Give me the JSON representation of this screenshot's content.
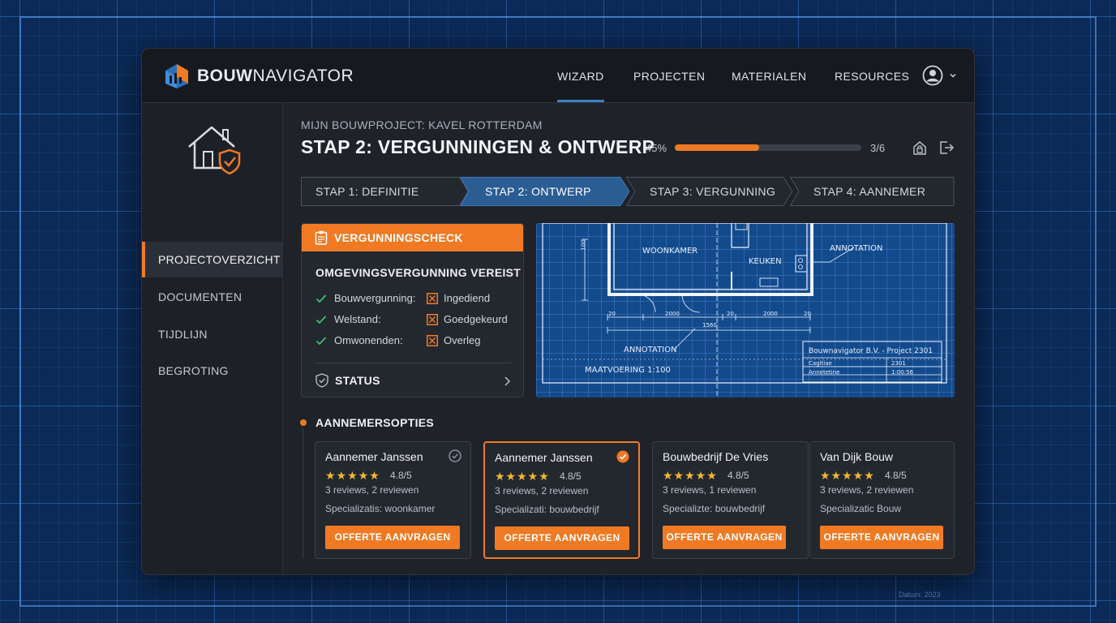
{
  "app": {
    "brand_bold": "BOUW",
    "brand_light": "NAVIGATOR"
  },
  "nav": {
    "items": [
      {
        "label": "WIZARD",
        "active": true
      },
      {
        "label": "PROJECTEN",
        "active": false
      },
      {
        "label": "MATERIALEN",
        "active": false
      },
      {
        "label": "RESOURCES",
        "active": false
      }
    ]
  },
  "sidebar": {
    "items": [
      {
        "label": "PROJECTOVERZICHT",
        "active": true
      },
      {
        "label": "DOCUMENTEN",
        "active": false
      },
      {
        "label": "TIJDLIJN",
        "active": false
      },
      {
        "label": "BEGROTING",
        "active": false
      }
    ]
  },
  "main": {
    "breadcrumb": "MIJN BOUWPROJECT: KAVEL ROTTERDAM",
    "title": "STAP 2: VERGUNNINGEN & ONTWERP",
    "progress_label": "45%",
    "progress_value": 0.45,
    "step_count": "3/6",
    "steps": [
      {
        "label": "STAP 1: DEFINITIE",
        "active": false
      },
      {
        "label": "STAP 2: ONTWERP",
        "active": true
      },
      {
        "label": "STAP 3: VERGUNNING",
        "active": false
      },
      {
        "label": "STAP 4: AANNEMER",
        "active": false
      }
    ]
  },
  "permit": {
    "header": "VERGUNNINGSCHECK",
    "subtitle": "OMGEVINGSVERGUNNING VEREIST",
    "rows": [
      {
        "key": "Bouwvergunning:",
        "value": "Ingediend"
      },
      {
        "key": "Welstand:",
        "value": "Goedgekeurd"
      },
      {
        "key": "Omwonenden:",
        "value": "Overleg"
      }
    ],
    "status_label": "STATUS"
  },
  "blueprint": {
    "room_living": "WOONKAMER",
    "room_kitchen": "KEUKEN",
    "annotation_1": "ANNOTATION",
    "annotation_2": "ANNOTATION",
    "scale": "MAATVOERING 1:100",
    "dims": [
      "20",
      "2000",
      "20",
      "2000",
      "20",
      "1560"
    ],
    "dim_left": "100",
    "titleblock_title": "Bouwnavigator B.V. - Project 2301",
    "titleblock_r1_k": "Cagltiae",
    "titleblock_r1_v": "2301",
    "titleblock_r2_k": "Annetetine",
    "titleblock_r2_v": "1:00:56"
  },
  "contractors": {
    "section_title": "AANNEMERSOPTIES",
    "cards": [
      {
        "name": "Aannemer Janssen",
        "rating": "4.8/5",
        "reviews": "3 reviews, 2 reviewen",
        "spec": "Specializatis: woonkamer",
        "button": "OFFERTE AANVRAGEN",
        "selected": false
      },
      {
        "name": "Aannemer Janssen",
        "rating": "4.8/5",
        "reviews": "3 reviews, 2 reviewen",
        "spec": "Specializati: bouwbedrijf",
        "button": "OFFERTE AANVRAGEN",
        "selected": true
      },
      {
        "name": "Bouwbedrijf De Vries",
        "rating": "4.8/5",
        "reviews": "3 reviews, 1 reviewen",
        "spec": "Specializte: bouwbedrijf",
        "button": "OFFERTE AANVRAGEN",
        "selected": false
      },
      {
        "name": "Van Dijk Bouw",
        "rating": "4.8/5",
        "reviews": "3 reviews, 2 reviewen",
        "spec": "Specializatic Bouw",
        "button": "OFFERTE AANVRAGEN",
        "selected": false
      }
    ],
    "stars_text": "★★★★★"
  },
  "background": {
    "datum": "Datum: 2023"
  },
  "colors": {
    "accent": "#f07a24",
    "nav_underline": "#3b82c4",
    "background": "#0b2a57",
    "panel": "#1f2329",
    "blueprint": "#134a8c"
  }
}
